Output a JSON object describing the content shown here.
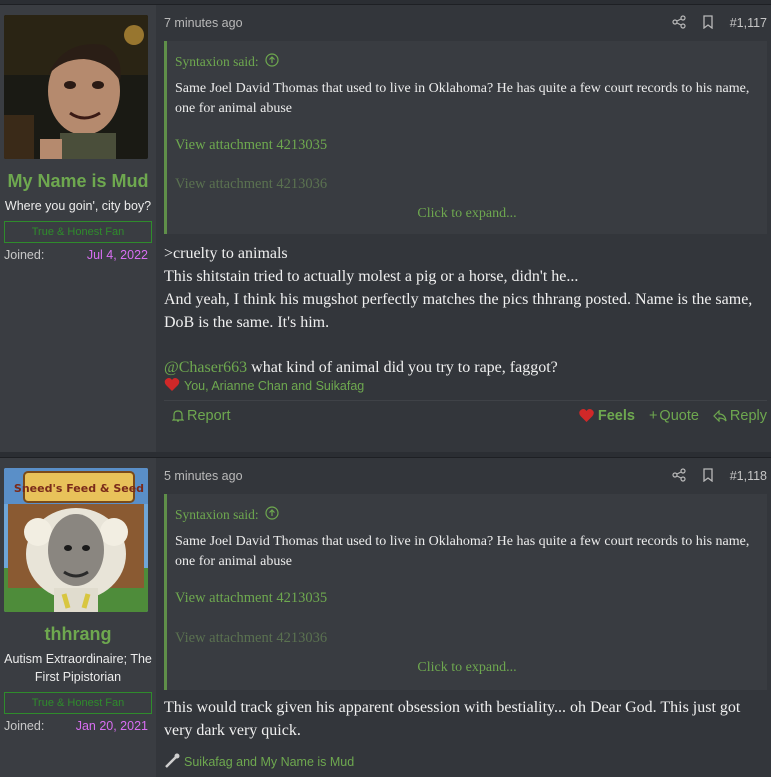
{
  "posts": [
    {
      "user": {
        "name": "My Name is Mud",
        "title": "Where you goin', city boy?",
        "banner": "True & Honest Fan",
        "joined_label": "Joined:",
        "joined_date": "Jul 4, 2022"
      },
      "time": "7 minutes ago",
      "number": "#1,117",
      "quote": {
        "author": "Syntaxion said:",
        "text": "Same Joel David Thomas that used to live in Oklahoma? He has quite a few court records to his name, one for animal abuse",
        "attachments": [
          "View attachment 4213035",
          "View attachment 4213036"
        ],
        "expand": "Click to expand..."
      },
      "body": [
        ">cruelty to animals",
        "This shitstain tried to actually molest a pig or a horse, didn't he...",
        "And yeah, I think his mugshot perfectly matches the pics thhrang posted. Name is the same, DoB is the same. It's him."
      ],
      "mention": "@Chaser663",
      "mention_text": " what kind of animal did you try to rape, faggot?",
      "reactions": "You, Arianne Chan and Suikafag",
      "actions": {
        "report": "Report",
        "feels": "Feels",
        "quote": "Quote",
        "reply": "Reply"
      }
    },
    {
      "user": {
        "name": "thhrang",
        "title": "Autism Extraordinaire; The First Pipistorian",
        "banner": "True & Honest Fan",
        "joined_label": "Joined:",
        "joined_date": "Jan 20, 2021",
        "avatar_sign": "Sneed's Feed & Seed"
      },
      "time": "5 minutes ago",
      "number": "#1,118",
      "quote": {
        "author": "Syntaxion said:",
        "text": "Same Joel David Thomas that used to live in Oklahoma? He has quite a few court records to his name, one for animal abuse",
        "attachments": [
          "View attachment 4213035",
          "View attachment 4213036"
        ],
        "expand": "Click to expand..."
      },
      "body": [
        "This would track given his apparent obsession with bestiality... oh Dear God. This just got very dark very quick."
      ],
      "reactions": "Suikafag and My Name is Mud"
    }
  ]
}
